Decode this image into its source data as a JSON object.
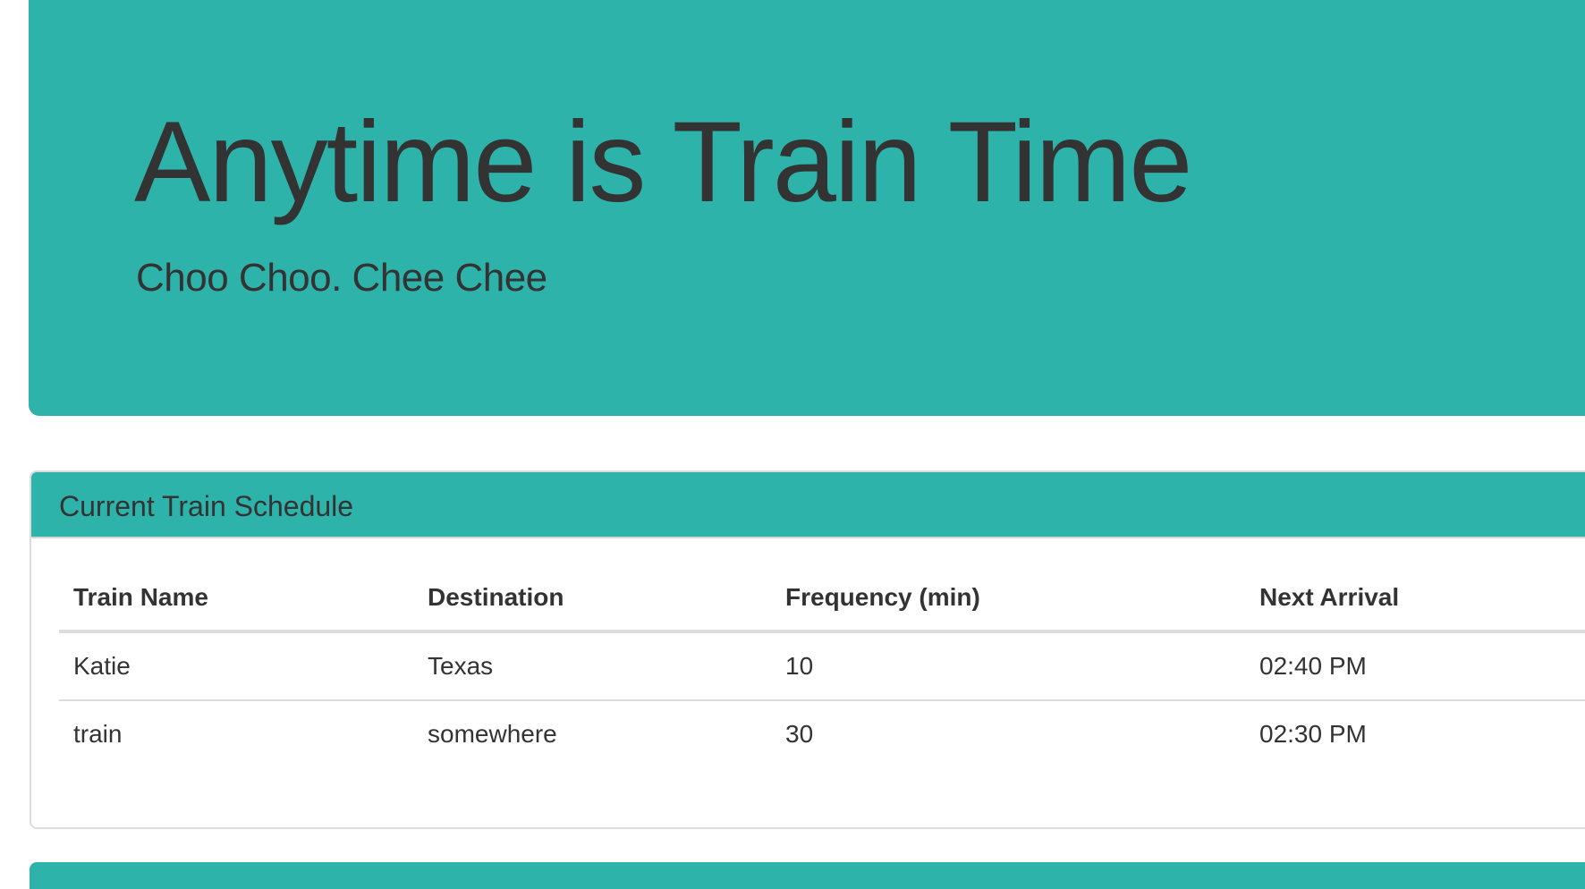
{
  "header": {
    "title": "Anytime is Train Time",
    "subtitle": "Choo Choo. Chee Chee"
  },
  "schedule": {
    "heading": "Current Train Schedule",
    "columns": [
      "Train Name",
      "Destination",
      "Frequency (min)",
      "Next Arrival"
    ],
    "rows": [
      [
        "Katie",
        "Texas",
        "10",
        "02:40 PM"
      ],
      [
        "train",
        "somewhere",
        "30",
        "02:30 PM"
      ]
    ]
  },
  "colors": {
    "accent": "#2db3aa",
    "text": "#333333",
    "border": "#dddddd"
  }
}
